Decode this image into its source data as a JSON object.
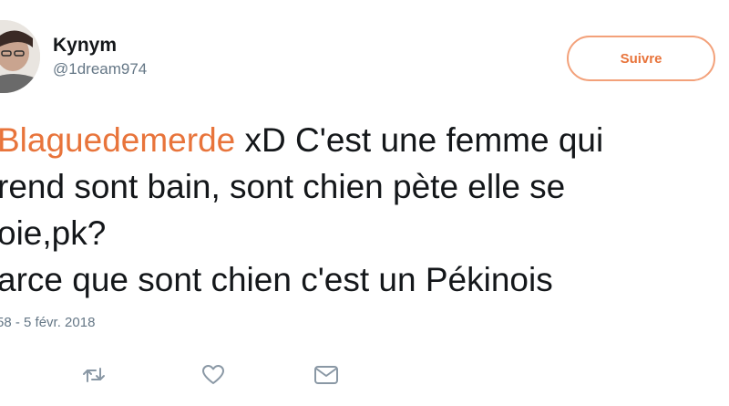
{
  "tweet": {
    "display_name": "Kynym",
    "handle": "@1dream974",
    "follow_label": "Suivre",
    "text": {
      "line1_hashtag": "Blaguedemerde",
      "line1_rest": " xD C'est une femme qui",
      "line2": "rend sont bain, sont chien pète elle se",
      "line3": "oie,pk?",
      "line4": "arce que sont chien c'est un Pékinois"
    },
    "timestamp": "58 - 5 févr. 2018"
  },
  "icons": {
    "retweet": "retweet-icon",
    "like": "heart-icon",
    "message": "envelope-icon"
  },
  "colors": {
    "accent": "#e8743b",
    "text": "#14171a",
    "muted": "#657786"
  }
}
